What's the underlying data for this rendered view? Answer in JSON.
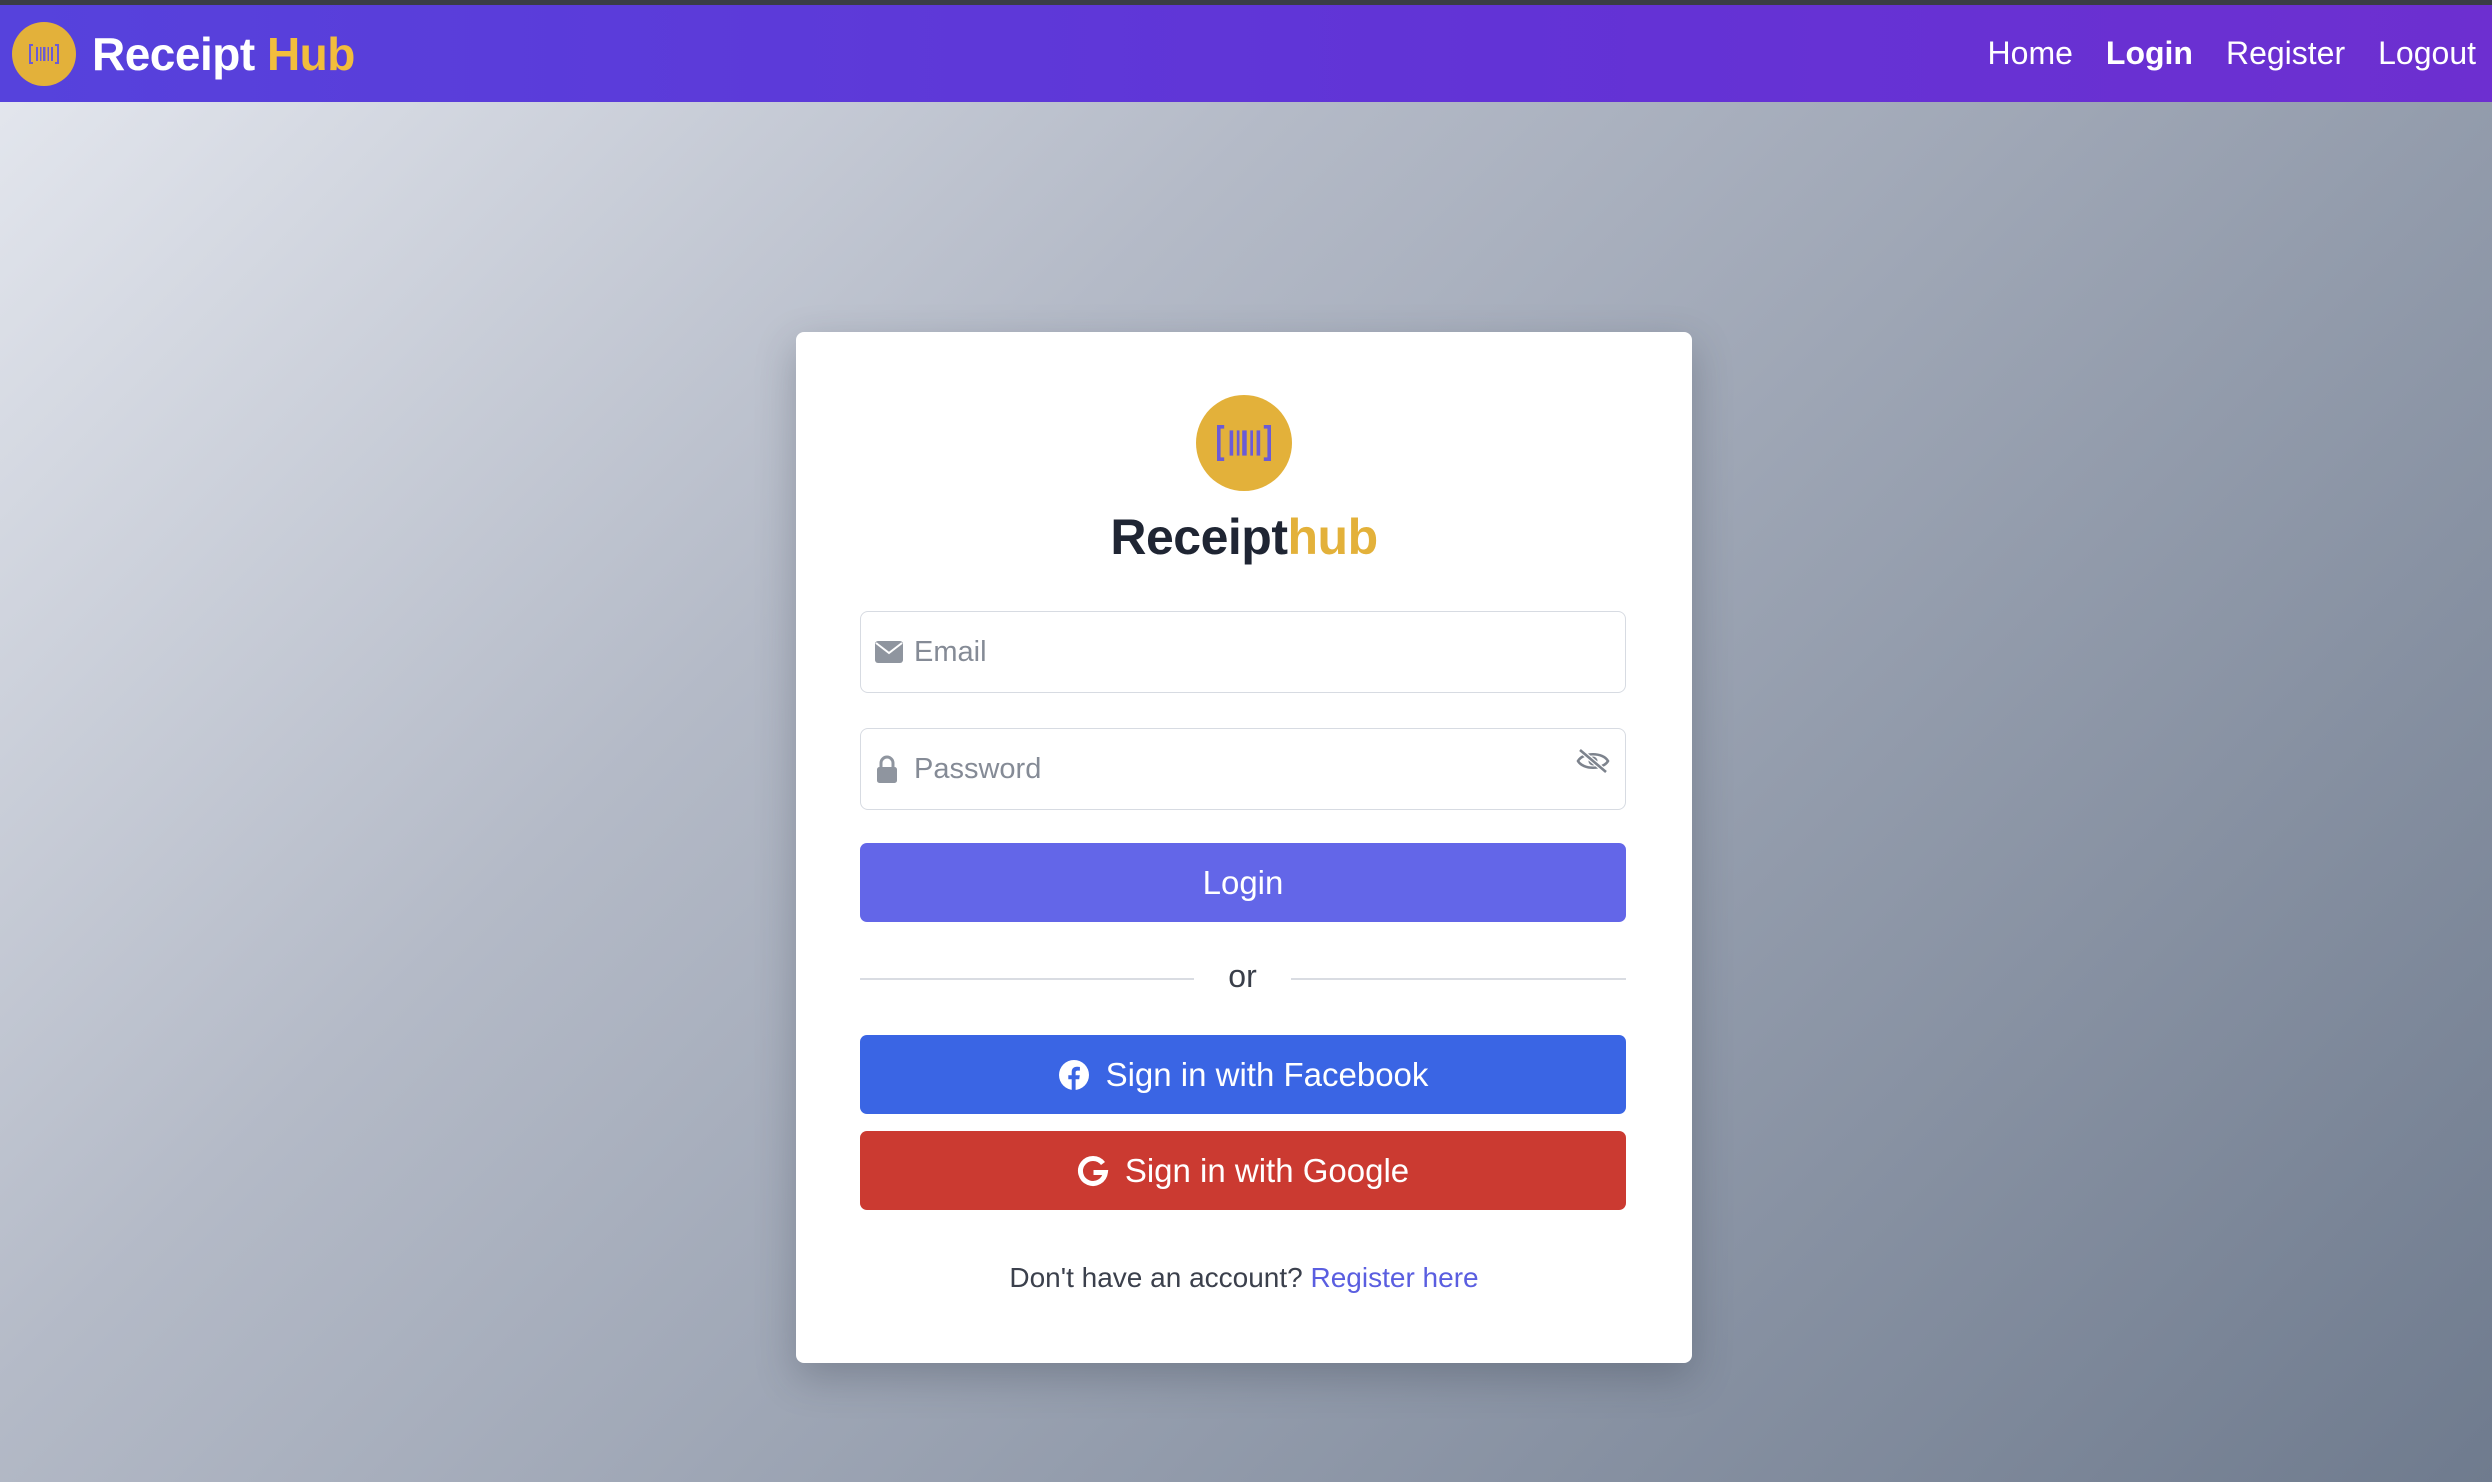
{
  "navbar": {
    "brand_first": "Receipt",
    "brand_second": "Hub",
    "links": [
      {
        "label": "Home"
      },
      {
        "label": "Login"
      },
      {
        "label": "Register"
      },
      {
        "label": "Logout"
      }
    ],
    "active_link": "Login"
  },
  "login_card": {
    "title_first": "Receipt",
    "title_second": "hub",
    "email_placeholder": "Email",
    "email_value": "",
    "password_placeholder": "Password",
    "password_value": "",
    "login_label": "Login",
    "divider": "or",
    "facebook_label": "Sign in with Facebook",
    "google_label": "Sign in with Google",
    "footer_prompt": "Don't have an account?",
    "footer_link": "Register here"
  },
  "icons": {
    "logo": "barcode-icon",
    "email": "envelope-icon",
    "password": "lock-icon",
    "toggle": "eye-slash-icon",
    "facebook": "facebook-icon",
    "google": "google-icon"
  },
  "colors": {
    "navbar_start": "#5642dc",
    "navbar_end": "#6d2fd0",
    "brand_accent": "#f2bd3c",
    "logo_bg": "#e3b13a",
    "login_button": "#6366e8",
    "facebook_button": "#3a65e4",
    "google_button": "#cb3a31",
    "link": "#5a5ee0"
  }
}
